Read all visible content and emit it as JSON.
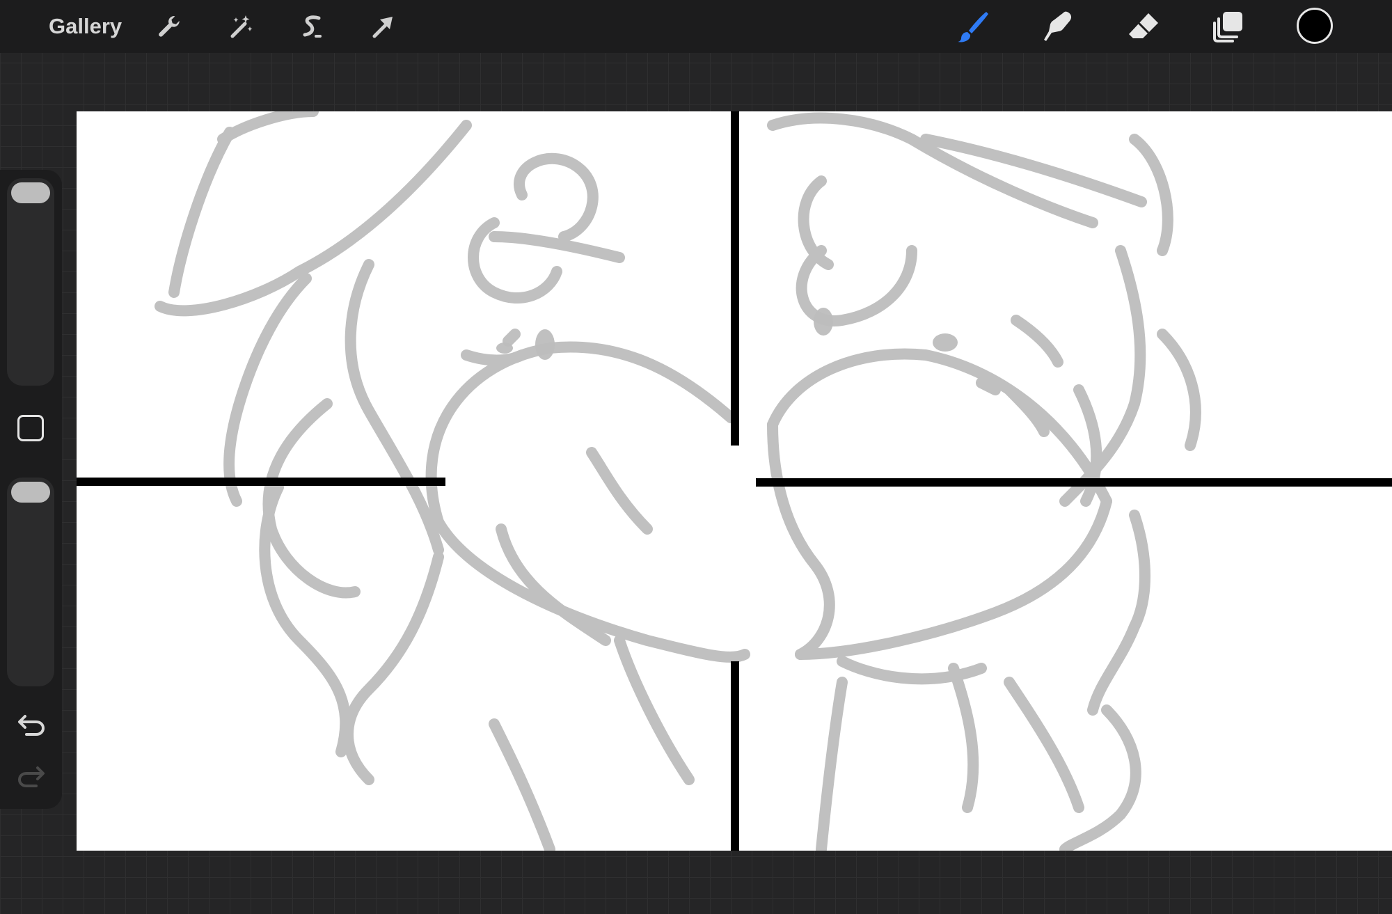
{
  "topbar": {
    "gallery_label": "Gallery",
    "tools_left": [
      {
        "name": "actions",
        "icon": "wrench-icon"
      },
      {
        "name": "adjustments",
        "icon": "magic-wand-icon"
      },
      {
        "name": "selection",
        "icon": "selection-s-icon"
      },
      {
        "name": "transform",
        "icon": "arrow-cursor-icon"
      }
    ],
    "tools_right": [
      {
        "name": "brush",
        "icon": "paintbrush-icon",
        "active": true,
        "color": "#2f7bf5"
      },
      {
        "name": "smudge",
        "icon": "smudge-finger-icon",
        "active": false
      },
      {
        "name": "eraser",
        "icon": "eraser-icon",
        "active": false
      },
      {
        "name": "layers",
        "icon": "layers-icon",
        "active": false
      }
    ],
    "current_color": "#000000"
  },
  "sidebar": {
    "brush_size": "slider",
    "modify": "square-icon",
    "opacity": "slider",
    "undo": "undo-icon",
    "redo": "redo-icon"
  },
  "colors": {
    "accent": "#2f7bf5",
    "ui_dark": "#1c1c1d",
    "canvas_bg": "#ffffff",
    "sketch_line": "#bdbdbd",
    "panel_line": "#000000"
  }
}
